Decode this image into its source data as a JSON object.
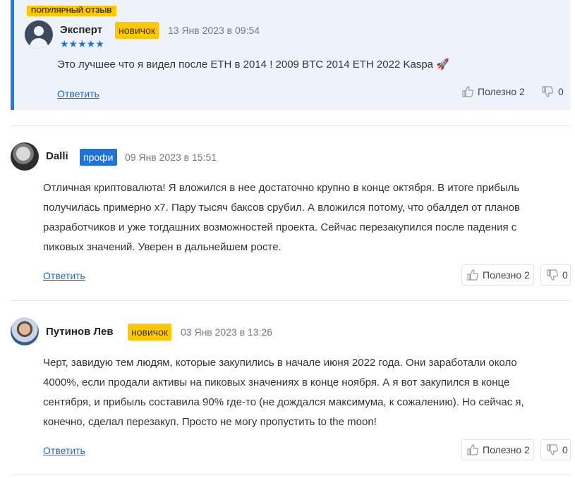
{
  "popular": {
    "badge": "ПОПУЛЯРНЫЙ ОТЗЫВ",
    "author": "Эксперт",
    "status": "новичок",
    "date": "13 Янв 2023 в 09:54",
    "stars": "★★★★★",
    "rating": 5,
    "text": "Это лучшее что я видел после ETH в 2014 ! 2009 BTC 2014 ETH 2022 Kaspa 🚀",
    "reply": "Ответить",
    "useful_label": "Полезно 2",
    "dislike_count": "0"
  },
  "comments": [
    {
      "author": "Dalli",
      "status": "профи",
      "date": "09 Янв 2023 в 15:51",
      "lines": [
        "Отличная криптовалюта! Я вложился в нее достаточно крупно в конце октября. В итоге прибыль",
        "получилась примерно х7. Пару тысяч баксов срубил. А вложился потому, что обалдел от планов",
        "разработчиков и уже тогдашних возможностей проекта. Сейчас перезакупился после падения с",
        "пиковых значений. Уверен в дальнейшем росте."
      ],
      "reply": "Ответить",
      "useful_label": "Полезно 2",
      "dislike_count": "0"
    },
    {
      "author": "Путинов Лев",
      "status": "новичок",
      "date": "03 Янв 2023 в 13:26",
      "lines": [
        "Черт, завидую тем людям, которые закупились в начале июня 2022 года. Они заработали около",
        "4000%, если продали активы на пиковых значениях в конце ноября. А я вот закупился в конце",
        "сентября, и прибыль составила 90% где-то (не дождался максимума, к сожалению). Но сейчас я,",
        "конечно, сделал перезакуп. Просто не могу пропустить to the moon!"
      ],
      "reply": "Ответить",
      "useful_label": "Полезно 2",
      "dislike_count": "0"
    }
  ],
  "colors": {
    "accent": "#1e73d6",
    "novice_badge": "#ffc800",
    "popular_bg": "#eef3fb",
    "link": "#1f66b8"
  }
}
